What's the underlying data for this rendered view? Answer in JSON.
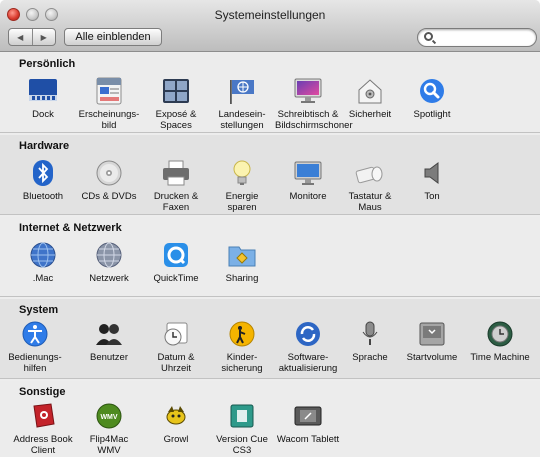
{
  "window": {
    "title": "Systemeinstellungen"
  },
  "toolbar": {
    "show_all_label": "Alle einblenden"
  },
  "search": {
    "value": "",
    "placeholder": ""
  },
  "sections": [
    {
      "title": "Persönlich",
      "items": [
        {
          "label": "Dock"
        },
        {
          "label": "Erscheinungs-\nbild"
        },
        {
          "label": "Exposé &\nSpaces"
        },
        {
          "label": "Landesein-\nstellungen"
        },
        {
          "label": "Schreibtisch &\nBildschirmschoner"
        },
        {
          "label": "Sicherheit"
        },
        {
          "label": "Spotlight"
        }
      ]
    },
    {
      "title": "Hardware",
      "items": [
        {
          "label": "Bluetooth"
        },
        {
          "label": "CDs & DVDs"
        },
        {
          "label": "Drucken &\nFaxen"
        },
        {
          "label": "Energie\nsparen"
        },
        {
          "label": "Monitore"
        },
        {
          "label": "Tastatur &\nMaus"
        },
        {
          "label": "Ton"
        }
      ]
    },
    {
      "title": "Internet & Netzwerk",
      "items": [
        {
          "label": ".Mac"
        },
        {
          "label": "Netzwerk"
        },
        {
          "label": "QuickTime"
        },
        {
          "label": "Sharing"
        }
      ]
    },
    {
      "title": "System",
      "items": [
        {
          "label": "Bedienungs-\nhilfen"
        },
        {
          "label": "Benutzer"
        },
        {
          "label": "Datum &\nUhrzeit"
        },
        {
          "label": "Kinder-\nsicherung"
        },
        {
          "label": "Software-\naktualisierung"
        },
        {
          "label": "Sprache"
        },
        {
          "label": "Startvolume"
        },
        {
          "label": "Time Machine"
        }
      ]
    },
    {
      "title": "Sonstige",
      "items": [
        {
          "label": "Address Book\nClient"
        },
        {
          "label": "Flip4Mac\nWMV"
        },
        {
          "label": "Growl"
        },
        {
          "label": "Version Cue\nCS3"
        },
        {
          "label": "Wacom Tablett"
        }
      ]
    }
  ]
}
